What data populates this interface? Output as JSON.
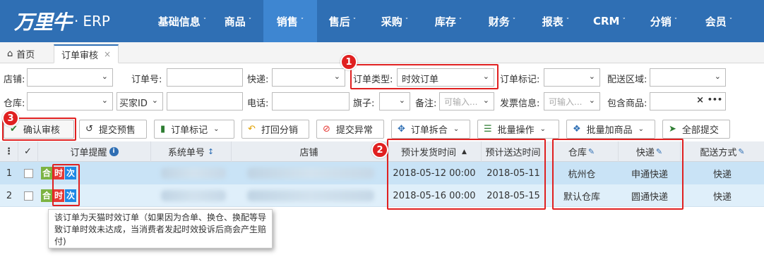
{
  "app": {
    "brand": "万里牛",
    "dot": "·",
    "product": "ERP"
  },
  "nav": {
    "items": [
      {
        "label": "基础信息",
        "active": false
      },
      {
        "label": "商品",
        "active": false
      },
      {
        "label": "销售",
        "active": true
      },
      {
        "label": "售后",
        "active": false
      },
      {
        "label": "采购",
        "active": false
      },
      {
        "label": "库存",
        "active": false
      },
      {
        "label": "财务",
        "active": false
      },
      {
        "label": "报表",
        "active": false
      },
      {
        "label": "CRM",
        "active": false
      },
      {
        "label": "分销",
        "active": false
      },
      {
        "label": "会员",
        "active": false
      }
    ],
    "caret": "˅"
  },
  "tabs": {
    "home": "首页",
    "order_review": "订单审核",
    "close": "×"
  },
  "filters": {
    "row1": {
      "shop_label": "店铺:",
      "order_no_label": "订单号:",
      "express_label": "快递:",
      "order_type_label": "订单类型:",
      "order_type_value": "时效订单",
      "order_mark_label": "订单标记:",
      "region_label": "配送区域:"
    },
    "row2": {
      "warehouse_label": "仓库:",
      "buyer_id_value": "买家ID",
      "phone_label": "电话:",
      "flag_label": "旗子:",
      "remark_label": "备注:",
      "remark_placeholder": "可输入...",
      "invoice_label": "发票信息:",
      "invoice_placeholder": "可输入...",
      "contains_label": "包含商品:",
      "clear": "×",
      "more": "•••"
    }
  },
  "toolbar": {
    "confirm": "确认审核",
    "submit_presale": "提交预售",
    "order_mark": "订单标记",
    "back_dist": "打回分销",
    "submit_exception": "提交异常",
    "split_merge": "订单拆合",
    "batch_ops": "批量操作",
    "batch_add": "批量加商品",
    "submit_all": "全部提交"
  },
  "table": {
    "headers": {
      "menu": "⋮",
      "check": "✓",
      "reminder": "订单提醒",
      "sys_no": "系统单号",
      "shop": "店铺",
      "ship_time": "预计发货时间",
      "arrive_time": "预计送达时间",
      "warehouse": "仓库",
      "express": "快递",
      "delivery": "配送方式"
    },
    "rows": [
      {
        "index": "1",
        "badges": [
          "合",
          "时",
          "次"
        ],
        "ship_time": "2018-05-12 00:00",
        "arrive_time": "2018-05-11",
        "warehouse": "杭州仓",
        "express": "申通快递",
        "delivery": "快递"
      },
      {
        "index": "2",
        "badges": [
          "合",
          "时",
          "次"
        ],
        "ship_time": "2018-05-16 00:00",
        "arrive_time": "2018-05-15",
        "warehouse": "默认仓库",
        "express": "圆通快递",
        "delivery": "快递"
      }
    ]
  },
  "tooltip": {
    "text": "该订单为天猫时效订单（如果因为合单、换仓、换配等导致订单时效未达成，当消费者发起时效投诉后商会产生赔付)"
  },
  "annotations": {
    "one": "1",
    "two": "2",
    "three": "3"
  },
  "colors": {
    "topbar": "#2f6fb4",
    "active_nav": "#3e86d1",
    "highlight": "#e02020",
    "row_selected": "#c9e3f6"
  }
}
